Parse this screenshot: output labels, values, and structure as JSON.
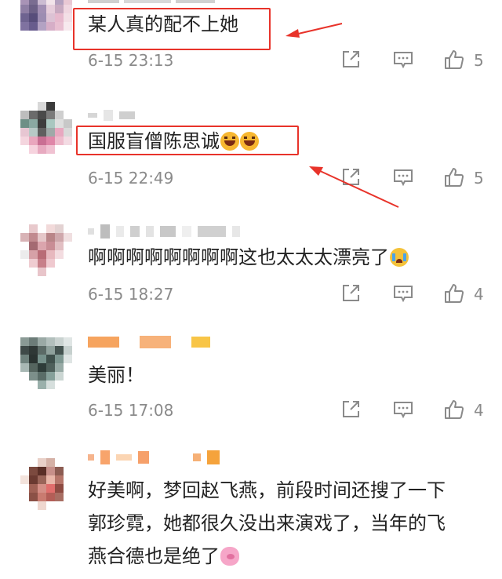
{
  "colors": {
    "accent_red": "#e8332a",
    "meta_gray": "#8a8a8a",
    "text": "#222222"
  },
  "comments": [
    {
      "text": "某人真的配不上她",
      "time": "6-15 23:13",
      "likes": "5",
      "highlighted": true
    },
    {
      "text": "国服盲僧陈思诚",
      "emojis": [
        "laugh-emoji",
        "laugh-emoji"
      ],
      "time": "6-15 22:49",
      "likes": "5",
      "highlighted": true
    },
    {
      "text": "啊啊啊啊啊啊啊啊这也太太太漂亮了",
      "emojis": [
        "cry-emoji"
      ],
      "time": "6-15 18:27",
      "likes": "4"
    },
    {
      "text": "美丽！",
      "time": "6-15 17:08",
      "likes": "4"
    },
    {
      "text_lines": [
        "好美啊，梦回赵飞燕，前段时间还搜了一下",
        "郭珍霓，她都很久没出来演戏了，当年的飞",
        "燕合德也是绝了"
      ],
      "emojis": [
        "pig-emoji"
      ]
    }
  ],
  "icons": {
    "share": "share-icon",
    "reply": "reply-icon",
    "like": "thumbs-up-icon"
  }
}
